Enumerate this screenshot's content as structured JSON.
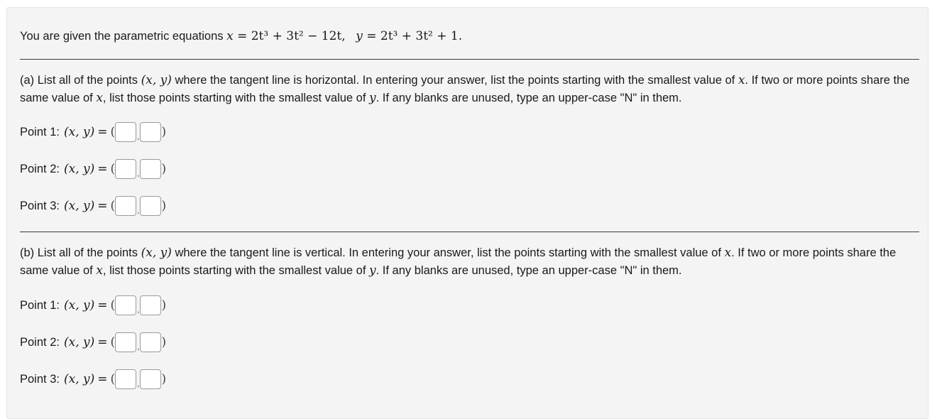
{
  "intro": {
    "text": "You are given the parametric equations",
    "eq_x_lhs": "x",
    "eq_x_rhs": "= 2t³ + 3t² − 12t,",
    "eq_y_lhs": "y",
    "eq_y_rhs": "= 2t³ + 3t² + 1."
  },
  "part_a": {
    "prompt_1": "(a) List all of the points",
    "pair": "(x, y)",
    "prompt_2": "where the tangent line is horizontal. In entering your answer, list the points starting with the smallest value of",
    "xvar": "x",
    "prompt_3": ". If two or more points share the same value of",
    "prompt_4": ", list those points starting with the smallest value of",
    "yvar": "y",
    "prompt_5": ". If any blanks are unused, type an upper-case \"N\" in them.",
    "points": [
      {
        "label": "Point 1:",
        "pair": "(x, y)",
        "eq": "=",
        "x_value": "",
        "y_value": ""
      },
      {
        "label": "Point 2:",
        "pair": "(x, y)",
        "eq": "=",
        "x_value": "",
        "y_value": ""
      },
      {
        "label": "Point 3:",
        "pair": "(x, y)",
        "eq": "=",
        "x_value": "",
        "y_value": ""
      }
    ]
  },
  "part_b": {
    "prompt_1": "(b) List all of the points",
    "pair": "(x, y)",
    "prompt_2": "where the tangent line is vertical. In entering your answer, list the points starting with the smallest value of",
    "xvar": "x",
    "prompt_3": ". If two or more points share the same value of",
    "prompt_4": ", list those points starting with the smallest value of",
    "yvar": "y",
    "prompt_5": ". If any blanks are unused, type an upper-case \"N\" in them.",
    "points": [
      {
        "label": "Point 1:",
        "pair": "(x, y)",
        "eq": "=",
        "x_value": "",
        "y_value": ""
      },
      {
        "label": "Point 2:",
        "pair": "(x, y)",
        "eq": "=",
        "x_value": "",
        "y_value": ""
      },
      {
        "label": "Point 3:",
        "pair": "(x, y)",
        "eq": "=",
        "x_value": "",
        "y_value": ""
      }
    ]
  },
  "colors": {
    "panel_background": "#f4f4f4",
    "separator": "#3a3a3a",
    "input_border": "#9a9a9a"
  }
}
